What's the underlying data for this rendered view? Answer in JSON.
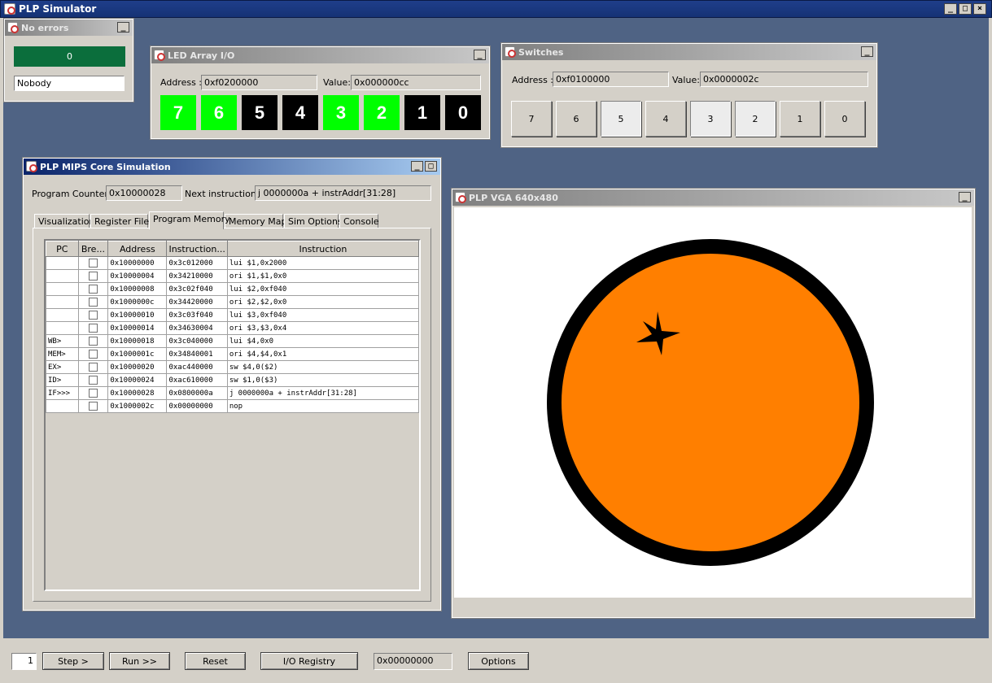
{
  "app": {
    "title": "PLP Simulator",
    "min_label": "_",
    "max_label": "□",
    "close_label": "×"
  },
  "errors": {
    "title": "No errors",
    "count": "0",
    "user": "Nobody"
  },
  "led": {
    "title": "LED Array I/O",
    "address_label": "Address :",
    "address": "0xf0200000",
    "value_label": "Value:",
    "value": "0x000000cc",
    "leds": [
      {
        "label": "7",
        "on": true
      },
      {
        "label": "6",
        "on": true
      },
      {
        "label": "5",
        "on": false
      },
      {
        "label": "4",
        "on": false
      },
      {
        "label": "3",
        "on": true
      },
      {
        "label": "2",
        "on": true
      },
      {
        "label": "1",
        "on": false
      },
      {
        "label": "0",
        "on": false
      }
    ],
    "on_color": "#00ff00",
    "off_color": "#000000"
  },
  "switches": {
    "title": "Switches",
    "address_label": "Address :",
    "address": "0xf0100000",
    "value_label": "Value:",
    "value": "0x0000002c",
    "buttons": [
      {
        "label": "7",
        "on": false
      },
      {
        "label": "6",
        "on": false
      },
      {
        "label": "5",
        "on": true
      },
      {
        "label": "4",
        "on": false
      },
      {
        "label": "3",
        "on": true
      },
      {
        "label": "2",
        "on": true
      },
      {
        "label": "1",
        "on": false
      },
      {
        "label": "0",
        "on": false
      }
    ]
  },
  "core": {
    "title": "PLP MIPS Core Simulation",
    "pc_label": "Program Counter:",
    "pc": "0x10000028",
    "next_label": "Next instruction:",
    "next": "j 0000000a + instrAddr[31:28]",
    "tabs": [
      "Visualization",
      "Register File",
      "Program Memory",
      "Memory Map",
      "Sim Options",
      "Console"
    ],
    "active_tab": 2,
    "columns": [
      "PC",
      "Bre...",
      "Address",
      "Instruction...",
      "Instruction"
    ],
    "rows": [
      {
        "pc": "",
        "addr": "0x10000000",
        "hex": "0x3c012000",
        "instr": "lui $1,0x2000"
      },
      {
        "pc": "",
        "addr": "0x10000004",
        "hex": "0x34210000",
        "instr": "ori $1,$1,0x0"
      },
      {
        "pc": "",
        "addr": "0x10000008",
        "hex": "0x3c02f040",
        "instr": "lui $2,0xf040"
      },
      {
        "pc": "",
        "addr": "0x1000000c",
        "hex": "0x34420000",
        "instr": "ori $2,$2,0x0"
      },
      {
        "pc": "",
        "addr": "0x10000010",
        "hex": "0x3c03f040",
        "instr": "lui $3,0xf040"
      },
      {
        "pc": "",
        "addr": "0x10000014",
        "hex": "0x34630004",
        "instr": "ori $3,$3,0x4"
      },
      {
        "pc": "WB>",
        "addr": "0x10000018",
        "hex": "0x3c040000",
        "instr": "lui $4,0x0"
      },
      {
        "pc": "MEM>",
        "addr": "0x1000001c",
        "hex": "0x34840001",
        "instr": "ori $4,$4,0x1"
      },
      {
        "pc": "EX>",
        "addr": "0x10000020",
        "hex": "0xac440000",
        "instr": "sw $4,0($2)"
      },
      {
        "pc": "ID>",
        "addr": "0x10000024",
        "hex": "0xac610000",
        "instr": "sw $1,0($3)"
      },
      {
        "pc": "IF>>>",
        "addr": "0x10000028",
        "hex": "0x0800000a",
        "instr": "j 0000000a + instrAddr[31:28]"
      },
      {
        "pc": "",
        "addr": "0x1000002c",
        "hex": "0x00000000",
        "instr": "nop"
      }
    ]
  },
  "vga": {
    "title": "PLP VGA 640x480",
    "fruit_color": "#ff7f00",
    "ring_color": "#000000"
  },
  "toolbar": {
    "step_count": "1",
    "step": "Step >",
    "run": "Run >>",
    "reset": "Reset",
    "io_registry": "I/O Registry",
    "value": "0x00000000",
    "options": "Options"
  }
}
